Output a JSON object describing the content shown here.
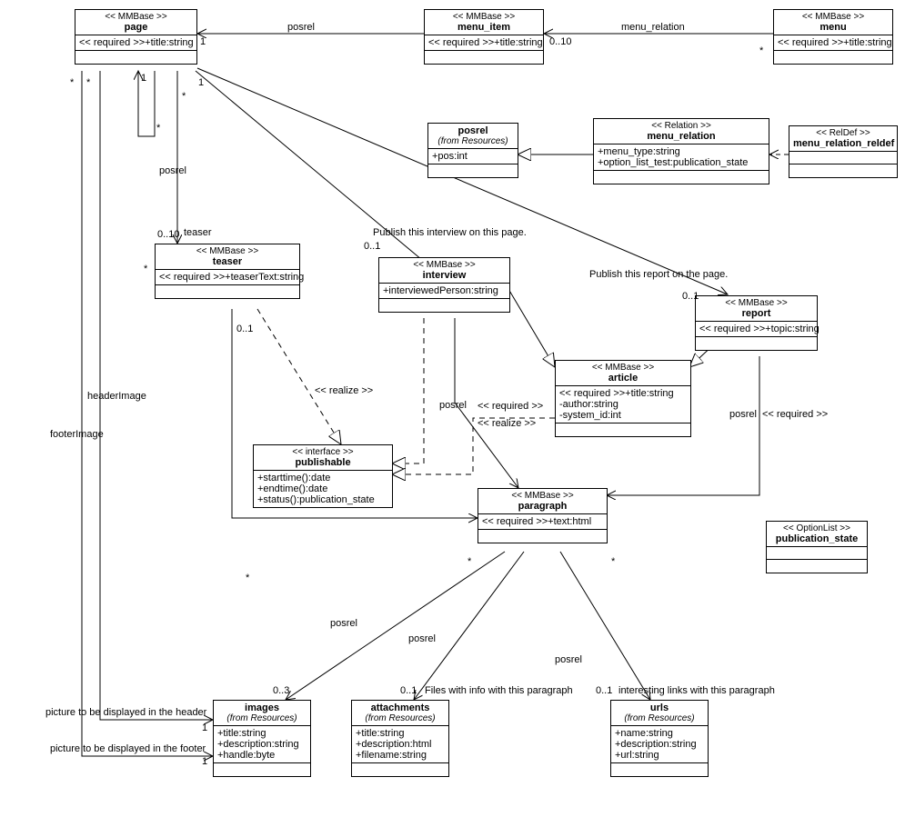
{
  "stereotypes": {
    "mmbase": "<< MMBase >>",
    "required": "<< required >>",
    "interface": "<< interface >>",
    "relation": "<< Relation >>",
    "reldef": "<< RelDef >>",
    "optionlist": "<< OptionList >>",
    "realize": "<< realize >>"
  },
  "classes": {
    "page": {
      "name": "page",
      "stereo": "mmbase",
      "attrs": [
        "+title:string"
      ],
      "attr_req": [
        "required"
      ]
    },
    "menu_item": {
      "name": "menu_item",
      "stereo": "mmbase",
      "attrs": [
        "+title:string"
      ],
      "attr_req": [
        "required"
      ]
    },
    "menu": {
      "name": "menu",
      "stereo": "mmbase",
      "attrs": [
        "+title:string"
      ],
      "attr_req": [
        "required"
      ]
    },
    "posrel": {
      "name": "posrel",
      "from": "(from Resources)",
      "attrs": [
        "+pos:int"
      ]
    },
    "menu_relation": {
      "name": "menu_relation",
      "stereo": "relation",
      "attrs": [
        "+menu_type:string",
        "+option_list_test:publication_state"
      ]
    },
    "menu_relation_reldef": {
      "name": "menu_relation_reldef",
      "stereo": "reldef"
    },
    "teaser": {
      "name": "teaser",
      "stereo": "mmbase",
      "attrs": [
        "+teaserText:string"
      ],
      "attr_req": [
        "required"
      ]
    },
    "interview": {
      "name": "interview",
      "stereo": "mmbase",
      "attrs": [
        "+interviewedPerson:string"
      ]
    },
    "report": {
      "name": "report",
      "stereo": "mmbase",
      "attrs": [
        "+topic:string"
      ],
      "attr_req": [
        "required"
      ]
    },
    "article": {
      "name": "article",
      "stereo": "mmbase",
      "attrs": [
        "+title:string",
        "-author:string",
        "-system_id:int"
      ],
      "attr_req": [
        "required",
        "",
        ""
      ]
    },
    "publishable": {
      "name": "publishable",
      "stereo": "interface",
      "ops": [
        "+starttime():date",
        "+endtime():date",
        "+status():publication_state"
      ]
    },
    "paragraph": {
      "name": "paragraph",
      "stereo": "mmbase",
      "attrs": [
        "+text:html"
      ],
      "attr_req": [
        "required"
      ]
    },
    "publication_state": {
      "name": "publication_state",
      "stereo": "optionlist"
    },
    "images": {
      "name": "images",
      "from": "(from Resources)",
      "attrs": [
        "+title:string",
        "+description:string",
        "+handle:byte"
      ]
    },
    "attachments": {
      "name": "attachments",
      "from": "(from Resources)",
      "attrs": [
        "+title:string",
        "+description:html",
        "+filename:string"
      ]
    },
    "urls": {
      "name": "urls",
      "from": "(from Resources)",
      "attrs": [
        "+name:string",
        "+description:string",
        "+url:string"
      ]
    }
  },
  "labels": {
    "posrel": "posrel",
    "menu_relation": "menu_relation",
    "teaser": "teaser",
    "headerImage": "headerImage",
    "footerImage": "footerImage",
    "header_note": "picture to be displayed in the header",
    "footer_note": "picture to be displayed in the footer",
    "pub_interview": "Publish this interview on this page.",
    "pub_report": "Publish this report on the page.",
    "files_note": "Files with info with this paragraph",
    "urls_note": "interesting links with this paragraph",
    "req_short": "<< required >>"
  },
  "mult": {
    "one": "1",
    "star": "*",
    "zero_ten": "0..10",
    "zero_one": "0..1",
    "zero_three": "0..3"
  },
  "chart_data": {
    "type": "uml_class_diagram",
    "classes": [
      {
        "id": "page",
        "stereotype": "MMBase",
        "attributes": [
          {
            "name": "title",
            "type": "string",
            "required": true
          }
        ]
      },
      {
        "id": "menu_item",
        "stereotype": "MMBase",
        "attributes": [
          {
            "name": "title",
            "type": "string",
            "required": true
          }
        ]
      },
      {
        "id": "menu",
        "stereotype": "MMBase",
        "attributes": [
          {
            "name": "title",
            "type": "string",
            "required": true
          }
        ]
      },
      {
        "id": "posrel",
        "from": "Resources",
        "attributes": [
          {
            "name": "pos",
            "type": "int"
          }
        ]
      },
      {
        "id": "menu_relation",
        "stereotype": "Relation",
        "attributes": [
          {
            "name": "menu_type",
            "type": "string"
          },
          {
            "name": "option_list_test",
            "type": "publication_state"
          }
        ]
      },
      {
        "id": "menu_relation_reldef",
        "stereotype": "RelDef"
      },
      {
        "id": "teaser",
        "stereotype": "MMBase",
        "attributes": [
          {
            "name": "teaserText",
            "type": "string",
            "required": true
          }
        ]
      },
      {
        "id": "interview",
        "stereotype": "MMBase",
        "attributes": [
          {
            "name": "interviewedPerson",
            "type": "string"
          }
        ]
      },
      {
        "id": "report",
        "stereotype": "MMBase",
        "attributes": [
          {
            "name": "topic",
            "type": "string",
            "required": true
          }
        ]
      },
      {
        "id": "article",
        "stereotype": "MMBase",
        "attributes": [
          {
            "name": "title",
            "type": "string",
            "required": true
          },
          {
            "name": "author",
            "type": "string",
            "vis": "private"
          },
          {
            "name": "system_id",
            "type": "int",
            "vis": "private"
          }
        ]
      },
      {
        "id": "publishable",
        "stereotype": "interface",
        "operations": [
          {
            "name": "starttime",
            "returns": "date"
          },
          {
            "name": "endtime",
            "returns": "date"
          },
          {
            "name": "status",
            "returns": "publication_state"
          }
        ]
      },
      {
        "id": "paragraph",
        "stereotype": "MMBase",
        "attributes": [
          {
            "name": "text",
            "type": "html",
            "required": true
          }
        ]
      },
      {
        "id": "publication_state",
        "stereotype": "OptionList"
      },
      {
        "id": "images",
        "from": "Resources",
        "attributes": [
          {
            "name": "title",
            "type": "string"
          },
          {
            "name": "description",
            "type": "string"
          },
          {
            "name": "handle",
            "type": "byte"
          }
        ]
      },
      {
        "id": "attachments",
        "from": "Resources",
        "attributes": [
          {
            "name": "title",
            "type": "string"
          },
          {
            "name": "description",
            "type": "html"
          },
          {
            "name": "filename",
            "type": "string"
          }
        ]
      },
      {
        "id": "urls",
        "from": "Resources",
        "attributes": [
          {
            "name": "name",
            "type": "string"
          },
          {
            "name": "description",
            "type": "string"
          },
          {
            "name": "url",
            "type": "string"
          }
        ]
      }
    ],
    "relationships": [
      {
        "type": "association",
        "name": "posrel",
        "from": "menu_item",
        "to": "page",
        "from_mult": "0..10",
        "to_mult": "1"
      },
      {
        "type": "association",
        "name": "menu_relation",
        "from": "menu",
        "to": "menu_item",
        "from_mult": "*",
        "to_mult": "0..10"
      },
      {
        "type": "association",
        "name": "posrel",
        "from": "page",
        "to": "page",
        "from_mult": "*",
        "to_mult": "1",
        "self": true
      },
      {
        "type": "association",
        "name": "teaser",
        "from": "page",
        "to": "teaser",
        "from_mult": "1",
        "to_mult": "0..10"
      },
      {
        "type": "association",
        "from": "page",
        "to": "interview",
        "from_mult": "1",
        "to_mult": "0..1",
        "note": "Publish this interview on this page."
      },
      {
        "type": "association",
        "from": "page",
        "to": "report",
        "from_mult": "1",
        "to_mult": "0..1",
        "note": "Publish this report on the page."
      },
      {
        "type": "association",
        "name": "headerImage",
        "from": "page",
        "to": "images",
        "from_mult": "*",
        "to_mult": "1",
        "note": "picture to be displayed in the header"
      },
      {
        "type": "association",
        "name": "footerImage",
        "from": "page",
        "to": "images",
        "from_mult": "*",
        "to_mult": "1",
        "note": "picture to be displayed in the footer"
      },
      {
        "type": "generalization",
        "from": "interview",
        "to": "article"
      },
      {
        "type": "generalization",
        "from": "report",
        "to": "article"
      },
      {
        "type": "generalization",
        "from": "menu_relation",
        "to": "posrel"
      },
      {
        "type": "realization",
        "from": "teaser",
        "to": "publishable"
      },
      {
        "type": "realization",
        "from": "interview",
        "to": "publishable"
      },
      {
        "type": "realization",
        "from": "article",
        "to": "publishable"
      },
      {
        "type": "dependency",
        "from": "menu_relation_reldef",
        "to": "menu_relation"
      },
      {
        "type": "association",
        "name": "posrel",
        "from": "teaser",
        "to": "paragraph",
        "from_mult": "0..1",
        "to_mult": "*"
      },
      {
        "type": "association",
        "name": "posrel",
        "from": "interview",
        "to": "paragraph",
        "to_mult": "*",
        "stereo": "required"
      },
      {
        "type": "association",
        "name": "posrel",
        "from": "report",
        "to": "paragraph",
        "to_mult": "*",
        "stereo": "required"
      },
      {
        "type": "association",
        "name": "posrel",
        "from": "paragraph",
        "to": "images",
        "from_mult": "*",
        "to_mult": "0..3"
      },
      {
        "type": "association",
        "name": "posrel",
        "from": "paragraph",
        "to": "attachments",
        "from_mult": "*",
        "to_mult": "0..1",
        "note": "Files with info with this paragraph"
      },
      {
        "type": "association",
        "name": "posrel",
        "from": "paragraph",
        "to": "urls",
        "from_mult": "*",
        "to_mult": "0..1",
        "note": "interesting links with this paragraph"
      }
    ]
  }
}
